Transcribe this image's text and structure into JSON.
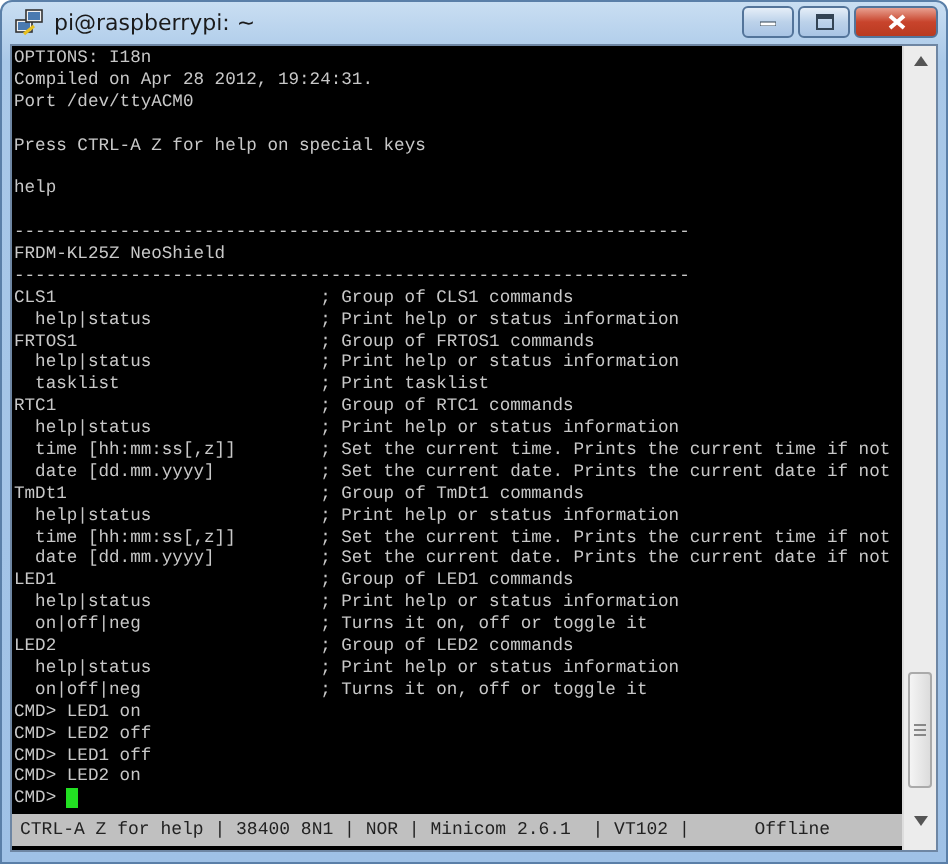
{
  "window": {
    "title": "pi@raspberrypi: ~"
  },
  "terminal": {
    "lines": [
      {
        "kind": "text",
        "text": "OPTIONS: I18n"
      },
      {
        "kind": "text",
        "text": "Compiled on Apr 28 2012, 19:24:31."
      },
      {
        "kind": "text",
        "text": "Port /dev/ttyACM0"
      },
      {
        "kind": "blank"
      },
      {
        "kind": "text",
        "text": "Press CTRL-A Z for help on special keys"
      },
      {
        "kind": "blank"
      },
      {
        "kind": "text",
        "text": "help"
      },
      {
        "kind": "blank"
      },
      {
        "kind": "text",
        "text": "----------------------------------------------------------------"
      },
      {
        "kind": "text",
        "text": "FRDM-KL25Z NeoShield"
      },
      {
        "kind": "text",
        "text": "----------------------------------------------------------------"
      },
      {
        "kind": "help",
        "command": "CLS1",
        "description": "; Group of CLS1 commands"
      },
      {
        "kind": "help",
        "command": "  help|status",
        "description": "; Print help or status information"
      },
      {
        "kind": "help",
        "command": "FRTOS1",
        "description": "; Group of FRTOS1 commands"
      },
      {
        "kind": "help",
        "command": "  help|status",
        "description": "; Print help or status information"
      },
      {
        "kind": "help",
        "command": "  tasklist",
        "description": "; Print tasklist"
      },
      {
        "kind": "help",
        "command": "RTC1",
        "description": "; Group of RTC1 commands"
      },
      {
        "kind": "help",
        "command": "  help|status",
        "description": "; Print help or status information"
      },
      {
        "kind": "help",
        "command": "  time [hh:mm:ss[,z]]",
        "description": "; Set the current time. Prints the current time if not"
      },
      {
        "kind": "help",
        "command": "  date [dd.mm.yyyy]",
        "description": "; Set the current date. Prints the current date if not"
      },
      {
        "kind": "help",
        "command": "TmDt1",
        "description": "; Group of TmDt1 commands"
      },
      {
        "kind": "help",
        "command": "  help|status",
        "description": "; Print help or status information"
      },
      {
        "kind": "help",
        "command": "  time [hh:mm:ss[,z]]",
        "description": "; Set the current time. Prints the current time if not"
      },
      {
        "kind": "help",
        "command": "  date [dd.mm.yyyy]",
        "description": "; Set the current date. Prints the current date if not"
      },
      {
        "kind": "help",
        "command": "LED1",
        "description": "; Group of LED1 commands"
      },
      {
        "kind": "help",
        "command": "  help|status",
        "description": "; Print help or status information"
      },
      {
        "kind": "help",
        "command": "  on|off|neg",
        "description": "; Turns it on, off or toggle it"
      },
      {
        "kind": "help",
        "command": "LED2",
        "description": "; Group of LED2 commands"
      },
      {
        "kind": "help",
        "command": "  help|status",
        "description": "; Print help or status information"
      },
      {
        "kind": "help",
        "command": "  on|off|neg",
        "description": "; Turns it on, off or toggle it"
      },
      {
        "kind": "text",
        "text": "CMD> LED1 on"
      },
      {
        "kind": "text",
        "text": "CMD> LED2 off"
      },
      {
        "kind": "text",
        "text": "CMD> LED1 off"
      },
      {
        "kind": "text",
        "text": "CMD> LED2 on"
      },
      {
        "kind": "prompt",
        "text": "CMD>",
        "cursor": true
      }
    ]
  },
  "status_bar": {
    "text": "CTRL-A Z for help | 38400 8N1 | NOR | Minicom 2.6.1  | VT102 |      Offline"
  }
}
